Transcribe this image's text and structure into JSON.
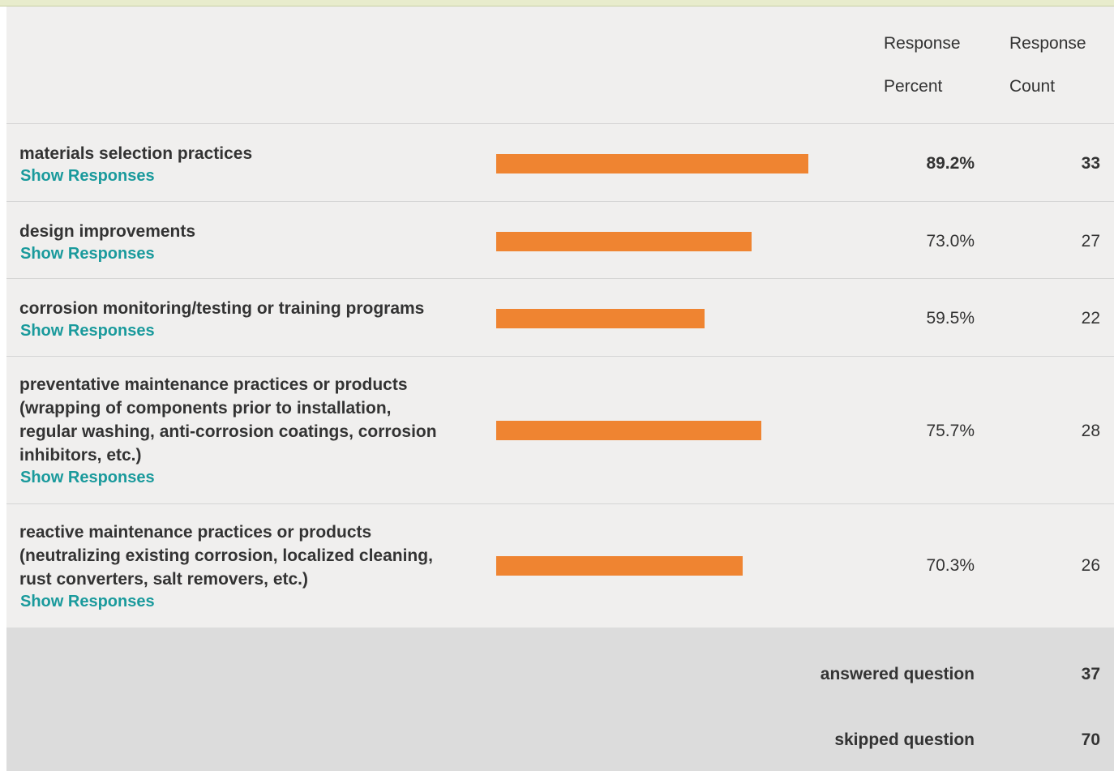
{
  "header": {
    "percent_line1": "Response",
    "percent_line2": "Percent",
    "count_line1": "Response",
    "count_line2": "Count"
  },
  "rows": [
    {
      "label": "materials selection practices",
      "link": "Show Responses",
      "percent": "89.2%",
      "percent_value": 89.2,
      "count": "33"
    },
    {
      "label": "design improvements",
      "link": "Show Responses",
      "percent": "73.0%",
      "percent_value": 73.0,
      "count": "27"
    },
    {
      "label": "corrosion monitoring/testing or training programs",
      "link": "Show Responses",
      "percent": "59.5%",
      "percent_value": 59.5,
      "count": "22"
    },
    {
      "label": "preventative maintenance practices or products (wrapping of components prior to installation, regular washing, anti-corrosion coatings, corrosion inhibitors, etc.)",
      "link": "Show Responses",
      "percent": "75.7%",
      "percent_value": 75.7,
      "count": "28"
    },
    {
      "label": "reactive maintenance practices or products (neutralizing existing corrosion, localized cleaning, rust converters, salt removers, etc.)",
      "link": "Show Responses",
      "percent": "70.3%",
      "percent_value": 70.3,
      "count": "26"
    }
  ],
  "footer": {
    "answered_label": "answered question",
    "answered_value": "37",
    "skipped_label": "skipped question",
    "skipped_value": "70"
  },
  "colors": {
    "bar": "#ef8431",
    "link": "#1a9a9c",
    "background": "#f0efee",
    "footer": "#dcdcdc"
  }
}
